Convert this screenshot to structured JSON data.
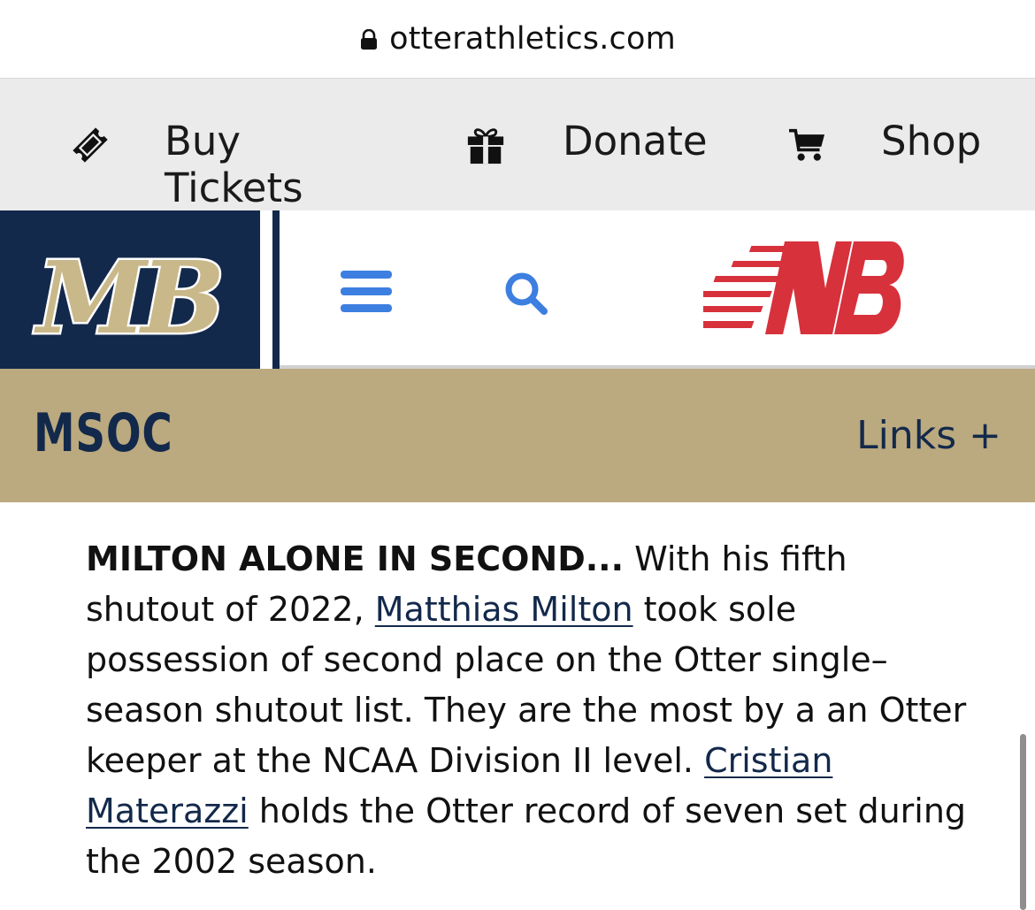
{
  "browser": {
    "url": "otterathletics.com"
  },
  "utility_nav": {
    "items": [
      {
        "label": "Buy Tickets",
        "icon": "ticket-icon"
      },
      {
        "label": "Donate",
        "icon": "gift-icon"
      },
      {
        "label": "Shop",
        "icon": "cart-icon"
      }
    ]
  },
  "brand": {
    "logo_text": "MB",
    "sponsor_logo_text": "NB",
    "colors": {
      "navy": "#13294b",
      "gold": "#bba97f",
      "sponsor_red": "#d7313c",
      "icon_blue": "#3d7fe0"
    }
  },
  "section": {
    "title": "MSOC",
    "links_label": "Links +"
  },
  "article": {
    "lead": "MILTON ALONE IN SECOND...",
    "text_1": " With his fifth shutout of 2022, ",
    "link_1": "Matthias Milton",
    "text_2": " took sole possession of second place on the Otter single–season shutout list. They are the most by a an Otter keeper at the NCAA Division II level. ",
    "link_2": "Cristian Materazzi",
    "text_3": " holds the Otter record of seven set during the 2002 season."
  }
}
